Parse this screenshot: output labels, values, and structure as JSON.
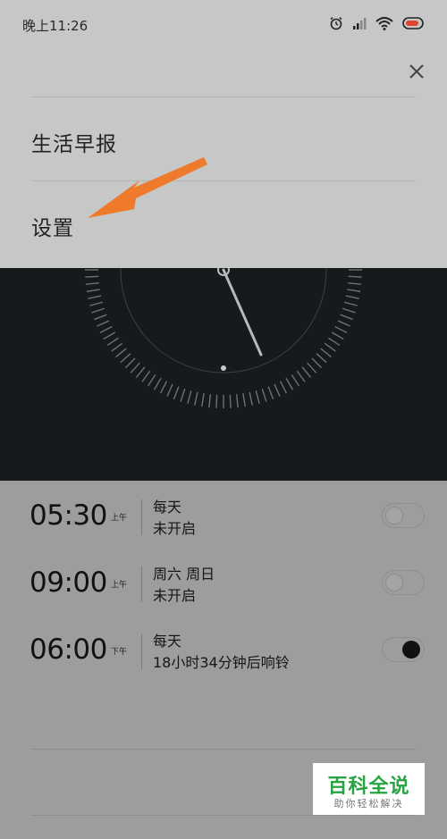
{
  "status_bar": {
    "time": "晚上11:26",
    "icons": [
      "alarm-icon",
      "signal-icon",
      "wifi-icon",
      "battery-icon"
    ]
  },
  "menu": {
    "close_icon": "close-icon",
    "items": [
      {
        "label": "生活早报"
      },
      {
        "label": "设置"
      }
    ],
    "highlight_arrow_color": "#f07a2c"
  },
  "clock": {
    "background": "#161a1c"
  },
  "alarms": [
    {
      "time": "05:30",
      "period": "上午",
      "repeat": "每天",
      "status": "未开启",
      "enabled": false
    },
    {
      "time": "09:00",
      "period": "上午",
      "repeat": "周六 周日",
      "status": "未开启",
      "enabled": false
    },
    {
      "time": "06:00",
      "period": "下午",
      "repeat": "每天",
      "status": "18小时34分钟后响铃",
      "enabled": true
    }
  ],
  "watermark": {
    "main": "百科全说",
    "sub": "助你轻松解决",
    "color": "#2aa443"
  }
}
